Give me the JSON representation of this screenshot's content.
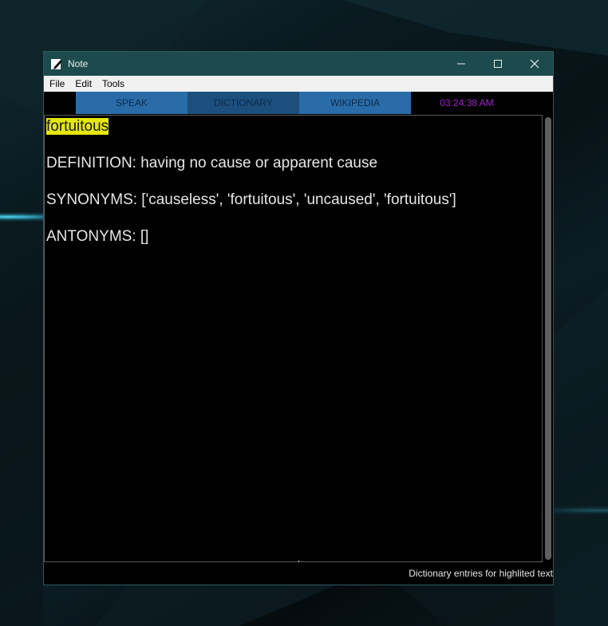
{
  "window": {
    "title": "Note",
    "icon": "pen-note-icon"
  },
  "menu": {
    "items": [
      "File",
      "Edit",
      "Tools"
    ]
  },
  "toolbar": {
    "speak_label": "SPEAK",
    "dictionary_label": "DICTIONARY",
    "wikipedia_label": "WIKIPEDIA",
    "clock": "03:24:38 AM"
  },
  "editor": {
    "highlighted_word": "fortuitous",
    "definition_line": "DEFINITION: having no cause or apparent cause",
    "synonyms_line": "SYNONYMS: ['causeless', 'fortuitous', 'uncaused', 'fortuitous']",
    "antonyms_line": "ANTONYMS: []"
  },
  "status": {
    "text": "Dictionary entries for highlited text"
  },
  "colors": {
    "titlebar": "#1d4a4c",
    "button": "#2a6ca8",
    "button_active": "#1c4f7d",
    "clock": "#a020c8",
    "highlight": "#e4e60f"
  }
}
